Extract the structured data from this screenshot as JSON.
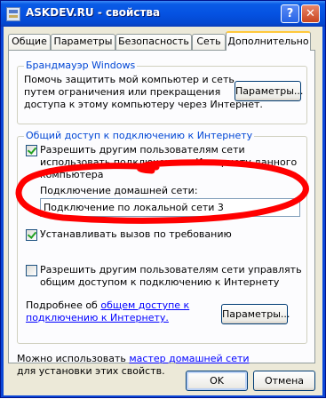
{
  "window": {
    "title": "ASKDEV.RU - свойства",
    "help_glyph": "?",
    "close_glyph": "✕"
  },
  "tabs": [
    {
      "label": "Общие",
      "active": false
    },
    {
      "label": "Параметры",
      "active": false
    },
    {
      "label": "Безопасность",
      "active": false
    },
    {
      "label": "Сеть",
      "active": false
    },
    {
      "label": "Дополнительно",
      "active": true
    }
  ],
  "firewall": {
    "title": "Брандмауэр Windows",
    "description_lines": [
      "Помочь защитить мой компьютер и сеть",
      "путем ограничения или прекращения",
      "доступа к этому компьютеру через Интернет."
    ],
    "settings_button": "Параметры..."
  },
  "ics": {
    "title": "Общий доступ к подключению к Интернету",
    "allow_sharing": {
      "checked": true,
      "label_lines": [
        "Разрешить другим пользователям сети",
        "использовать подключение к Интернету данного",
        "компьютера"
      ]
    },
    "home_network_label": "Подключение домашней сети:",
    "home_network_value": "Подключение по локальной сети 3",
    "dial_on_demand": {
      "checked": true,
      "label": "Устанавливать вызов по требованию"
    },
    "allow_control": {
      "checked": false,
      "label_lines": [
        "Разрешить другим пользователям сети управлять",
        "общим доступом к подключению к Интернету"
      ]
    },
    "more_info_prefix": "Подробнее об ",
    "more_info_link_line1": "общем доступе к",
    "more_info_link_line2": "подключению к Интернету.",
    "settings_button": "Параметры..."
  },
  "footer": {
    "text_prefix": "Можно использовать ",
    "wizard_link": "мастер домашней сети",
    "text_line2": "для установки этих свойств."
  },
  "buttons": {
    "ok": "OK",
    "cancel": "Отмена"
  },
  "colors": {
    "titlebar": "#0552e2",
    "dialog_bg": "#ece9d8",
    "panel_bg": "#fcfcfe",
    "group_title": "#0046d5",
    "link": "#0000ff",
    "annotation_red": "#ff0000"
  }
}
